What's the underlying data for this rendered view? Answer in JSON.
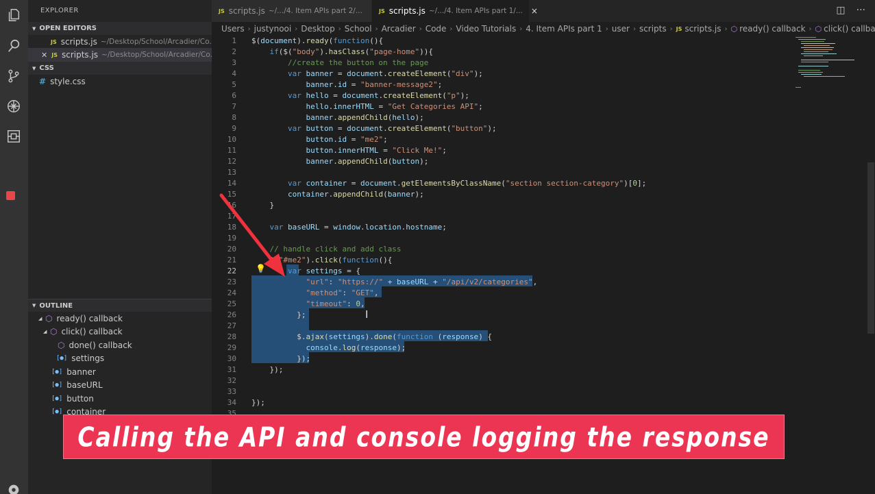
{
  "sidebar": {
    "title": "EXPLORER",
    "open_editors_label": "OPEN EDITORS",
    "open_editors": [
      {
        "name": "scripts.js",
        "path": "~/Desktop/School/Arcadier/Co..."
      },
      {
        "name": "scripts.js",
        "path": "~/Desktop/School/Arcadier/Co..."
      }
    ],
    "folder_label": "CSS",
    "files": [
      {
        "name": "style.css"
      }
    ],
    "outline_label": "OUTLINE",
    "outline": [
      {
        "label": "ready() callback"
      },
      {
        "label": "click() callback"
      },
      {
        "label": "done() callback"
      },
      {
        "label": "settings"
      },
      {
        "label": "banner"
      },
      {
        "label": "baseURL"
      },
      {
        "label": "button"
      },
      {
        "label": "container"
      }
    ]
  },
  "tabs": [
    {
      "name": "scripts.js",
      "path": "~/.../4. Item APIs part 2/..."
    },
    {
      "name": "scripts.js",
      "path": "~/.../4. Item APIs part 1/...",
      "close": "×"
    }
  ],
  "breadcrumb": {
    "items": [
      "Users",
      "justynooi",
      "Desktop",
      "School",
      "Arcadier",
      "Code",
      "Video Tutorials",
      "4. Item APIs part 1",
      "user",
      "scripts"
    ],
    "file": "scripts.js",
    "symbols": [
      "ready() callback",
      "click() callback"
    ]
  },
  "code": {
    "line_numbers": [
      "1",
      "2",
      "3",
      "4",
      "5",
      "6",
      "7",
      "8",
      "9",
      "10",
      "11",
      "12",
      "13",
      "14",
      "15",
      "16",
      "17",
      "18",
      "19",
      "20",
      "21",
      "22",
      "23",
      "24",
      "25",
      "26",
      "27",
      "28",
      "29",
      "30",
      "31",
      "32",
      "33",
      "34",
      "35"
    ],
    "current_line": "22"
  },
  "caption": "Calling the API and console logging the response",
  "colors": {
    "caption_bg": "#ec3553",
    "selection": "#264f78",
    "annotation_arrow": "#f0313e"
  }
}
